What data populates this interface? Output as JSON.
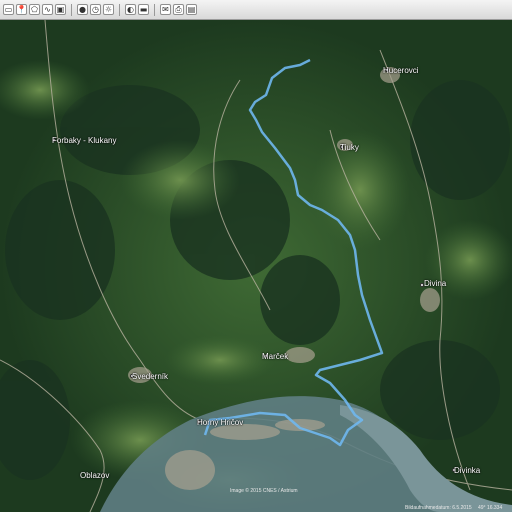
{
  "toolbar": {
    "buttons": [
      {
        "icon": "hide-sidebar-icon",
        "glyph": "▭"
      },
      {
        "icon": "placemark-icon",
        "glyph": "📍"
      },
      {
        "icon": "polygon-icon",
        "glyph": "⬠"
      },
      {
        "icon": "path-icon",
        "glyph": "∿"
      },
      {
        "icon": "image-overlay-icon",
        "glyph": "▣"
      },
      {
        "icon": "record-tour-icon",
        "glyph": "●"
      },
      {
        "icon": "historical-imagery-icon",
        "glyph": "◷"
      },
      {
        "icon": "sun-icon",
        "glyph": "☼"
      },
      {
        "icon": "planets-icon",
        "glyph": "◐"
      },
      {
        "icon": "ruler-icon",
        "glyph": "▬"
      },
      {
        "icon": "email-icon",
        "glyph": "✉"
      },
      {
        "icon": "print-icon",
        "glyph": "⎙"
      },
      {
        "icon": "save-image-icon",
        "glyph": "▤"
      }
    ]
  },
  "map": {
    "places": [
      {
        "name": "Hucerovci",
        "marker": true
      },
      {
        "name": "Tiuky",
        "marker": true
      },
      {
        "name": "Forbaky - Klukany",
        "marker": true
      },
      {
        "name": "Divina",
        "marker": true
      },
      {
        "name": "Marček",
        "marker": true
      },
      {
        "name": "Svederník",
        "marker": true
      },
      {
        "name": "Horný Hričov",
        "marker": true
      },
      {
        "name": "Oblazov",
        "marker": false
      },
      {
        "name": "Divinka",
        "marker": true
      }
    ],
    "route_color": "#6fb7ee",
    "river_color": "#6d8a8f",
    "attribution": "Image © 2015 CNES / Astrium",
    "status_date": "Bildaufnahmedatum: 6.5.2015",
    "status_coords": "49° 16.334"
  }
}
